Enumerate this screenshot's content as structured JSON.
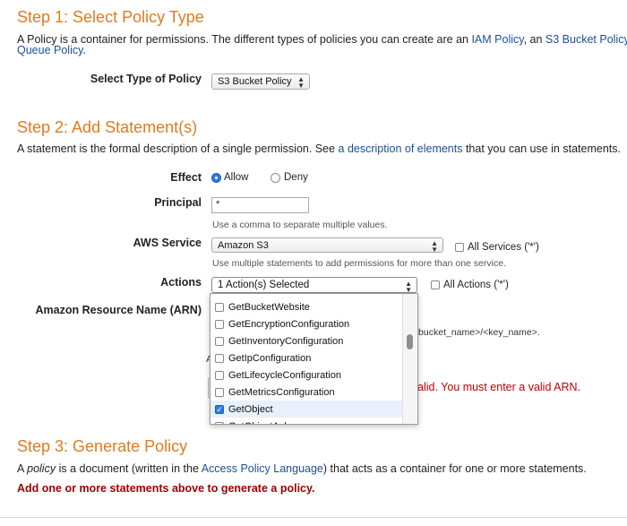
{
  "step1": {
    "title": "Step 1: Select Policy Type",
    "desc_before": "A Policy is a container for permissions. The different types of policies you can create are an ",
    "iam_link": "IAM Policy",
    "desc_mid": ", an ",
    "s3_link": "S3 Bucket Policy",
    "desc_after": ", a",
    "queue_link": "Queue Policy",
    "desc_end": ".",
    "policy_type_label": "Select Type of Policy",
    "policy_type_value": "S3 Bucket Policy"
  },
  "step2": {
    "title": "Step 2: Add Statement(s)",
    "desc_before": "A statement is the formal description of a single permission. See ",
    "desc_link": "a description of elements",
    "desc_after": " that you can use in statements.",
    "effect_label": "Effect",
    "effect_allow": "Allow",
    "effect_deny": "Deny",
    "principal_label": "Principal",
    "principal_value": "*",
    "principal_hint": "Use a comma to separate multiple values.",
    "service_label": "AWS Service",
    "service_value": "Amazon S3",
    "all_services_label": "All Services ('*')",
    "service_hint": "Use multiple statements to add permissions for more than one service.",
    "actions_label": "Actions",
    "actions_value": "1 Action(s) Selected",
    "all_actions_label": "All Actions ('*')",
    "arn_label": "Amazon Resource Name (ARN)",
    "arn_hint_fragment": ":<bucket_name>/<key_name>.",
    "arn_a_fragment": "A",
    "error_fragment": "alid. You must enter a valid ARN.",
    "action_options": [
      {
        "label": "GetBucketWebsite",
        "checked": false
      },
      {
        "label": "GetEncryptionConfiguration",
        "checked": false
      },
      {
        "label": "GetInventoryConfiguration",
        "checked": false
      },
      {
        "label": "GetIpConfiguration",
        "checked": false
      },
      {
        "label": "GetLifecycleConfiguration",
        "checked": false
      },
      {
        "label": "GetMetricsConfiguration",
        "checked": false
      },
      {
        "label": "GetObject",
        "checked": true
      },
      {
        "label": "GetObjectAcl",
        "checked": false
      }
    ]
  },
  "step3": {
    "title": "Step 3: Generate Policy",
    "desc_a": "A ",
    "desc_policy_word": "policy",
    "desc_b": " is a document (written in the ",
    "desc_link": "Access Policy Language",
    "desc_c": ") that acts as a container for one or more statements.",
    "warning": "Add one or more statements above to generate a policy."
  },
  "colors": {
    "heading": "#e07b1f",
    "link": "#1b4f9a",
    "error": "#c00000",
    "selected_accent": "#2b7be4"
  }
}
